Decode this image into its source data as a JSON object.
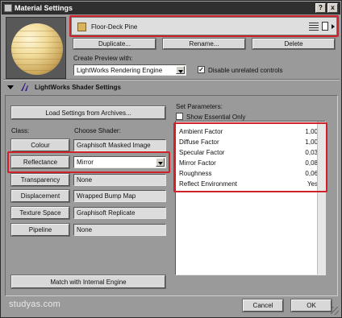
{
  "window": {
    "title": "Material Settings",
    "help_glyph": "?",
    "close_glyph": "x"
  },
  "material": {
    "name": "Floor-Deck Pine",
    "swatch_color": "#d8b45a"
  },
  "buttons": {
    "duplicate": "Duplicate...",
    "rename": "Rename...",
    "delete": "Delete",
    "load_settings": "Load Settings from Archives...",
    "match_engine": "Match with Internal Engine",
    "cancel": "Cancel",
    "ok": "OK"
  },
  "preview": {
    "label": "Create Preview with:",
    "engine": "LightWorks Rendering Engine",
    "disable_unrelated_label": "Disable unrelated controls",
    "disable_unrelated_checked": true,
    "check_glyph": "✓"
  },
  "shader_section": {
    "title": "LightWorks Shader Settings",
    "class_label": "Class:",
    "choose_shader_label": "Choose Shader:",
    "rows": [
      {
        "class": "Colour",
        "shader": "Graphisoft Masked Image",
        "editable": false
      },
      {
        "class": "Reflectance",
        "shader": "Mirror",
        "editable": true
      },
      {
        "class": "Transparency",
        "shader": "None",
        "editable": false
      },
      {
        "class": "Displacement",
        "shader": "Wrapped Bump Map",
        "editable": false
      },
      {
        "class": "Texture Space",
        "shader": "Graphisoft Replicate",
        "editable": false
      },
      {
        "class": "Pipeline",
        "shader": "None",
        "editable": false
      }
    ]
  },
  "parameters": {
    "label": "Set Parameters:",
    "show_essential_label": "Show Essential Only",
    "show_essential_checked": false,
    "items": [
      {
        "name": "Ambient Factor",
        "value": "1,00"
      },
      {
        "name": "Diffuse Factor",
        "value": "1,00"
      },
      {
        "name": "Specular Factor",
        "value": "0,03"
      },
      {
        "name": "Mirror Factor",
        "value": "0,08"
      },
      {
        "name": "Roughness",
        "value": "0,06"
      },
      {
        "name": "Reflect Environment",
        "value": "Yes"
      }
    ]
  },
  "highlight_color": "#d0202a",
  "watermark": "studyas.com"
}
